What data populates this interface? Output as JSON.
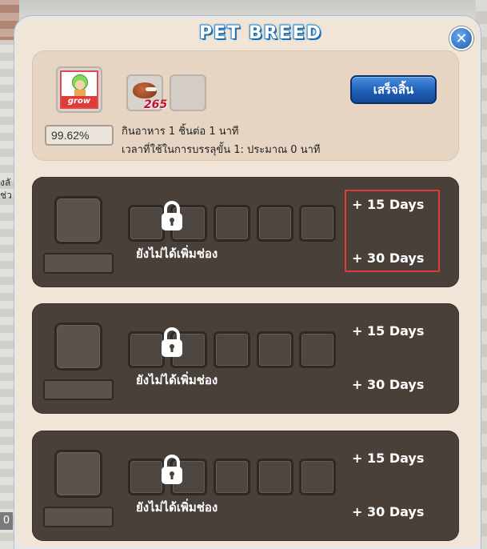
{
  "window": {
    "title": "PET BREED",
    "close_symbol": "✕"
  },
  "info": {
    "pet_label": "grow",
    "food_count": "265",
    "progress": "99.62%",
    "progress_value": 0.9962,
    "line1": "กินอาหาร 1 ชิ้นต่อ 1 นาที",
    "line2": "เวลาที่ใช้ในการบรรลุขั้น 1: ประมาณ 0 นาที",
    "finish_label": "เสร็จสิ้น"
  },
  "background": {
    "side_text": "งลั ช่ว",
    "badge": "0"
  },
  "rows": [
    {
      "locked_text": "ยังไม่ได้เพิ่มช่อง",
      "add15": "+ 15  Days",
      "add30": "+ 30  Days",
      "highlighted": true
    },
    {
      "locked_text": "ยังไม่ได้เพิ่มช่อง",
      "add15": "+ 15  Days",
      "add30": "+ 30  Days",
      "highlighted": false
    },
    {
      "locked_text": "ยังไม่ได้เพิ่มช่อง",
      "add15": "+ 15  Days",
      "add30": "+ 30  Days",
      "highlighted": false
    }
  ],
  "icons": {
    "lock": "padlock-icon",
    "close": "close-icon",
    "pet": "pet-avatar-icon",
    "food": "meat-icon"
  },
  "colors": {
    "accent_blue": "#1f5fb8",
    "row_bg": "#4a403a",
    "panel_bg": "#f0e5d6",
    "highlight": "#e03b3b",
    "food_count": "#c8102e"
  }
}
